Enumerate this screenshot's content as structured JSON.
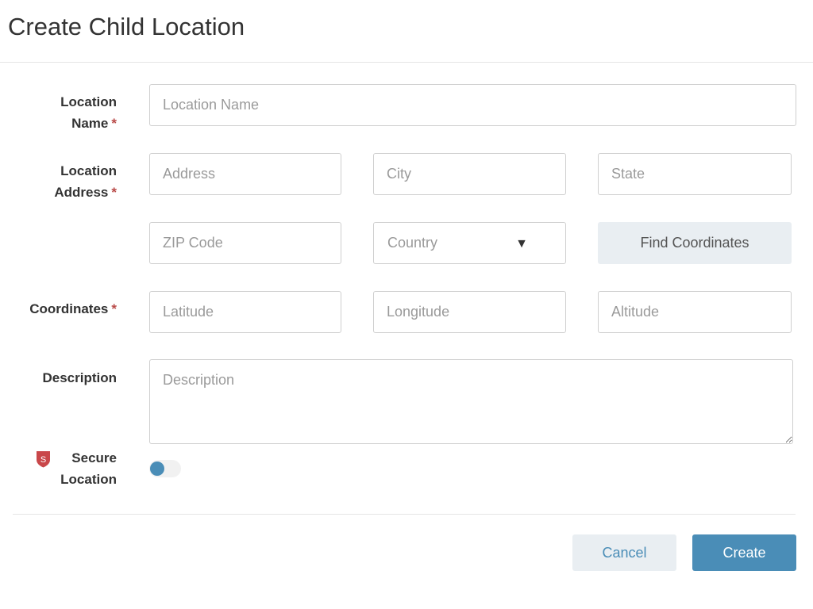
{
  "dialog": {
    "title": "Create Child Location"
  },
  "labels": {
    "location_name": "Location",
    "location_name_2": "Name",
    "location_address": "Location",
    "location_address_2": "Address",
    "coordinates": "Coordinates",
    "description": "Description",
    "secure": "Secure",
    "secure_2": "Location",
    "required_mark": "*"
  },
  "fields": {
    "location_name": {
      "placeholder": "Location Name",
      "value": ""
    },
    "address": {
      "placeholder": "Address",
      "value": ""
    },
    "city": {
      "placeholder": "City",
      "value": ""
    },
    "state": {
      "placeholder": "State",
      "value": ""
    },
    "zip": {
      "placeholder": "ZIP Code",
      "value": ""
    },
    "country": {
      "selected": "Country"
    },
    "latitude": {
      "placeholder": "Latitude",
      "value": ""
    },
    "longitude": {
      "placeholder": "Longitude",
      "value": ""
    },
    "altitude": {
      "placeholder": "Altitude",
      "value": ""
    },
    "description": {
      "placeholder": "Description",
      "value": ""
    }
  },
  "buttons": {
    "find_coordinates": "Find Coordinates",
    "cancel": "Cancel",
    "create": "Create"
  },
  "secure_toggle": {
    "on": false
  },
  "icons": {
    "secure": "shield-icon",
    "country_caret": "caret-down-icon",
    "shield_letter": "S"
  },
  "colors": {
    "accent": "#4a8db7",
    "required": "#b94a48",
    "secondary_button": "#e9eef2",
    "shield": "#c9474a"
  }
}
